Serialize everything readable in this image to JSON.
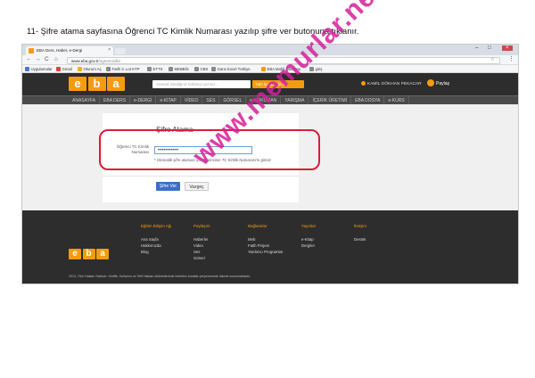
{
  "caption": "11- Şifre atama sayfasına Öğrenci TC Kimlik Numarası yazılıp şifre ver butonuna tıklanır.",
  "browser": {
    "tab_title": "EBA Ders, Haber, e-Dergi",
    "url_host": "www.eba.gov.tr",
    "url_path": "/ogrencisifre",
    "back_glyph": "←",
    "forward_glyph": "→",
    "reload_glyph": "C",
    "home_glyph": "⌂",
    "star_glyph": "☆",
    "menu_glyph": "⋮",
    "tab_close_glyph": "×",
    "win_min": "–",
    "win_max": "□",
    "win_close": "×",
    "bookmarks": [
      {
        "label": "Uygulamalar",
        "color": "#4a79c8"
      },
      {
        "label": "Gmail",
        "color": "#d44638"
      },
      {
        "label": "Oturum Aç",
        "color": "#f4b400"
      },
      {
        "label": "Fatih 3. Lot KTP",
        "color": "#888888"
      },
      {
        "label": "ETTS",
        "color": "#888888"
      },
      {
        "label": "MEBBİS",
        "color": "#888888"
      },
      {
        "label": "CBS",
        "color": "#888888"
      },
      {
        "label": "Gans Excel Türkiye",
        "color": "#888888"
      },
      {
        "label": "EBA Mobil Oturumu",
        "color": "#f39c12"
      },
      {
        "label": "giriş",
        "color": "#888888"
      }
    ]
  },
  "eba": {
    "logo_letters": [
      "e",
      "b",
      "a"
    ],
    "search_placeholder": "Aramak istediğiniz kelimeyi yazınız...",
    "search_button": "Tüm İçeriklerde Ara",
    "user_name": "KAMİL GÖKHAN PEKACAR",
    "share_label": "Paylaş",
    "nav": [
      "ANASAYFA",
      "EBA DERS",
      "e-DERGİ",
      "e-KİTAP",
      "VİDEO",
      "SES",
      "GÖRSEL",
      "e-DOKÜMAN",
      "YARIŞMA",
      "İÇERİK ÜRETİMİ",
      "EBA DOSYA",
      "e-KURS"
    ]
  },
  "form": {
    "title": "Şifre Atama",
    "label": "Öğrenci TC Kimlik Numarası",
    "input_value": "•••••••••••",
    "note_star": "*",
    "note_text": "Otomatik şifre ataması için öğrencinin TC Kimlik Numarası'nı giriniz",
    "submit": "Şifre Ver",
    "cancel": "Vazgeç"
  },
  "footer": {
    "columns": [
      {
        "heading": "Eğitim Bilişim Ağı",
        "items": [
          "Ana Sayfa",
          "Hakkımızda",
          "Blog"
        ]
      },
      {
        "heading": "Paylaşım",
        "items": [
          "Haberler",
          "Video",
          "Ses",
          "Görsel"
        ]
      },
      {
        "heading": "Bağlantılar",
        "items": [
          "Meb",
          "Fatih Projesi",
          "Yardımcı Programlar"
        ]
      },
      {
        "heading": "Yayınlar",
        "items": [
          "e-Kitap",
          "Dergiler"
        ]
      },
      {
        "heading": "İletişim",
        "items": [
          "Destek"
        ]
      }
    ],
    "copyright": "2013, Tüm Hakları Saklıdır. Gizlilik, Kullanım ve Telif Hakları bildirimlerinde belirtilen kurallar çerçevesinde hizmet sunulmaktadır."
  },
  "watermark": "www.memurlar.net",
  "colors": {
    "brand_orange": "#f39c12",
    "highlight_red": "#d61f3a",
    "watermark_magenta": "#d4219a",
    "primary_blue": "#3b6fc4"
  }
}
